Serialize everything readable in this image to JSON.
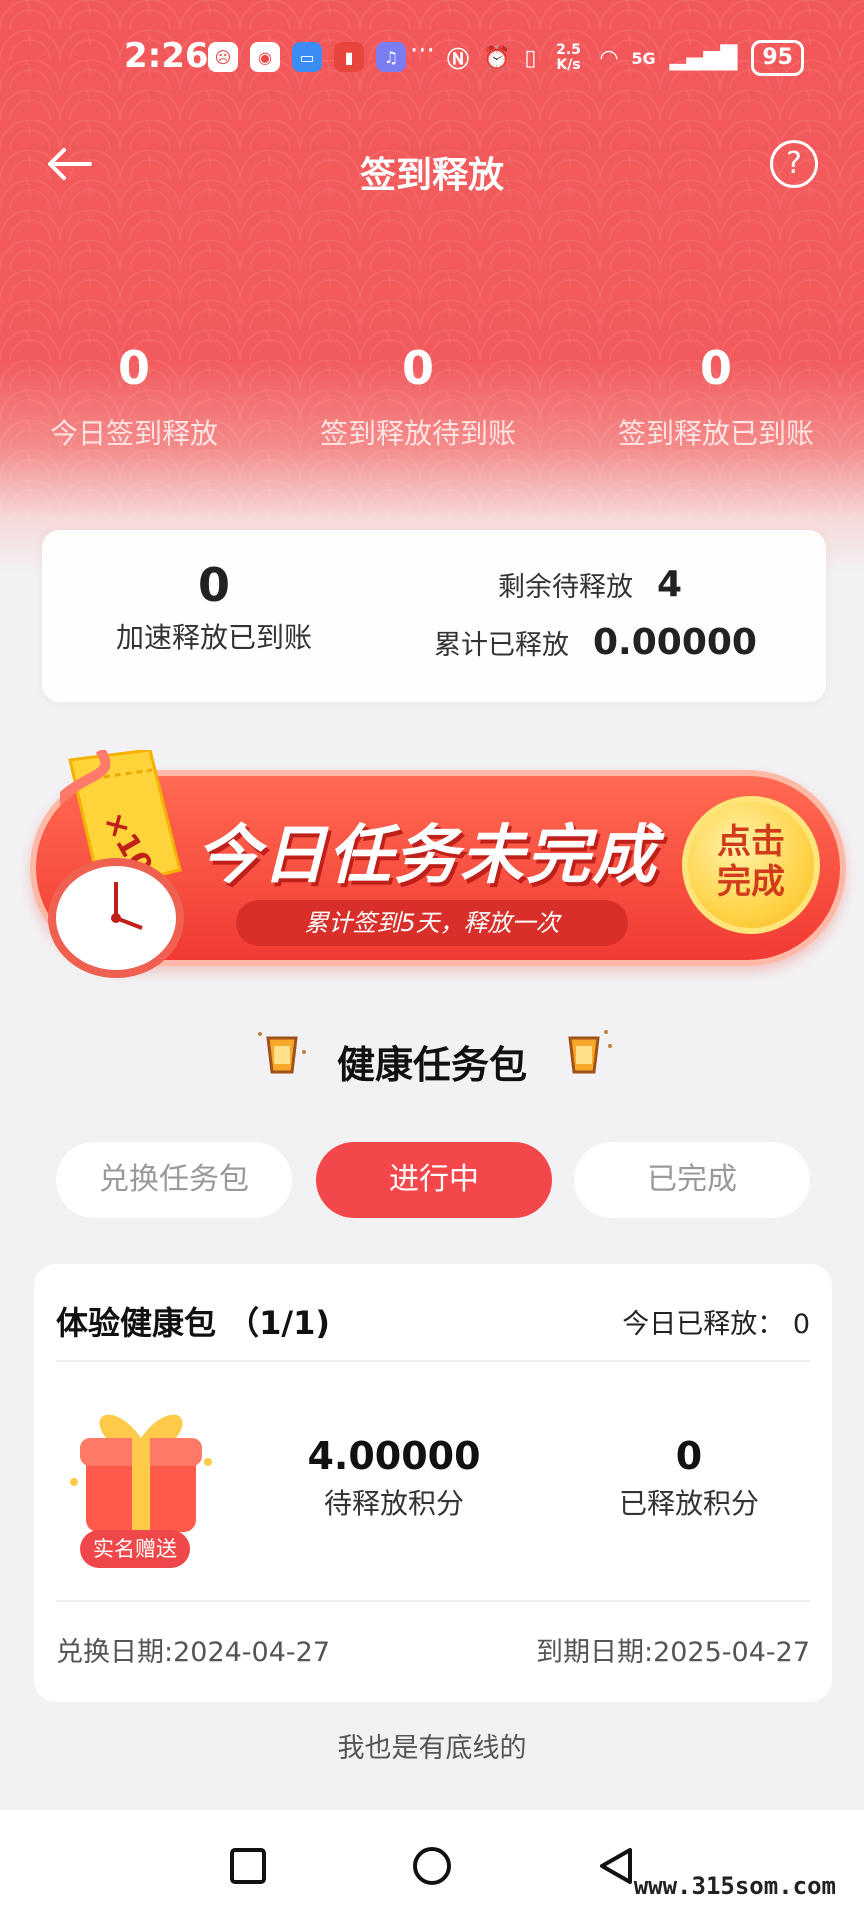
{
  "status_bar": {
    "time": "2:26",
    "more": "···",
    "network_speed": "2.5 K/s",
    "signal": "5G",
    "battery": "95"
  },
  "nav": {
    "title": "签到释放",
    "help": "?"
  },
  "stats": [
    {
      "value": "0",
      "label": "今日签到释放"
    },
    {
      "value": "0",
      "label": "签到释放待到账"
    },
    {
      "value": "0",
      "label": "签到释放已到账"
    }
  ],
  "summary": {
    "accel_value": "0",
    "accel_label": "加速释放已到账",
    "remaining_label": "剩余待释放",
    "remaining_value": "4",
    "total_label": "累计已释放",
    "total_value": "0.00000"
  },
  "banner": {
    "title": "今日任务未完成",
    "subtitle": "累计签到5天，释放一次",
    "button": "点击完成",
    "ticket": "×100"
  },
  "section": {
    "title": "健康任务包"
  },
  "tabs": [
    {
      "label": "兑换任务包",
      "active": false
    },
    {
      "label": "进行中",
      "active": true
    },
    {
      "label": "已完成",
      "active": false
    }
  ],
  "task_card": {
    "title": "体验健康包 （1/1)",
    "today_released": "今日已释放：  0",
    "badge": "实名赠送",
    "pending_value": "4.00000",
    "pending_label": "待释放积分",
    "released_value": "0",
    "released_label": "已释放积分",
    "exchange_date": "兑换日期:2024-04-27",
    "expire_date": "到期日期:2025-04-27"
  },
  "footer_note": "我也是有底线的",
  "watermark": "www.315som.com",
  "colors": {
    "primary": "#f4474c",
    "header": "#f2585a",
    "gold": "#ffd44a"
  }
}
